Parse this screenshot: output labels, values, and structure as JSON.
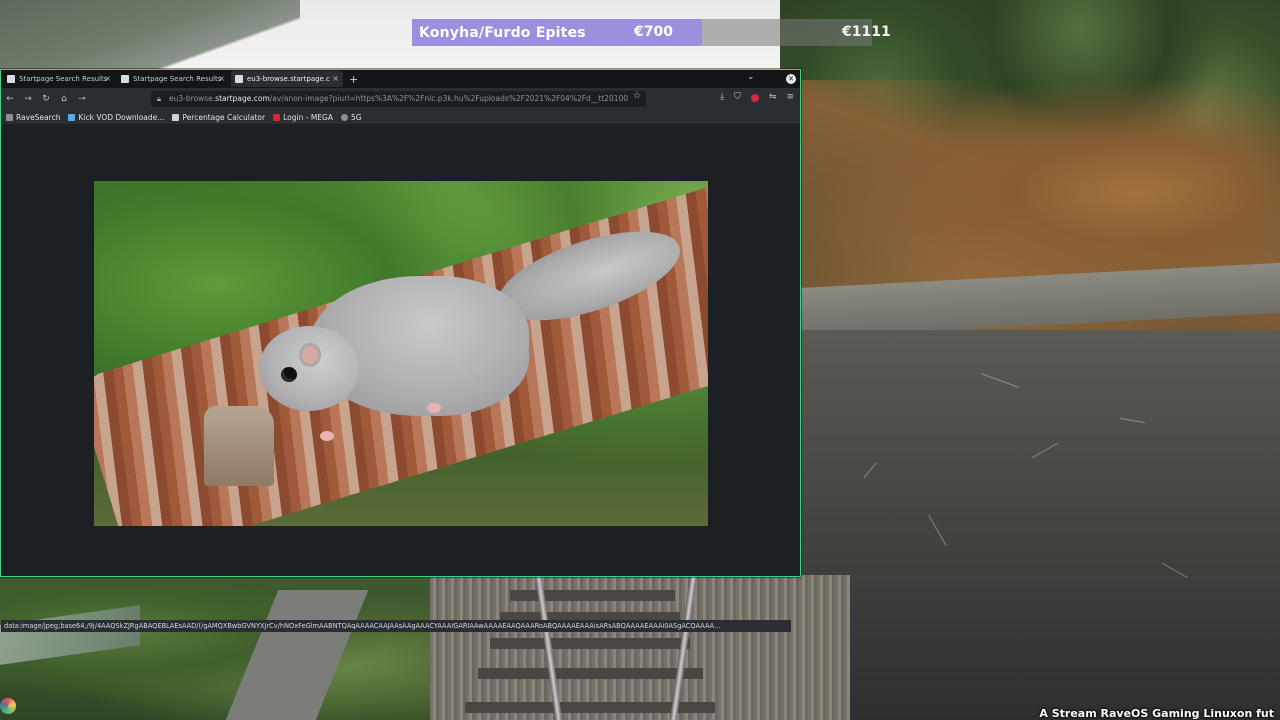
{
  "donation": {
    "title": "Konyha/Furdo Epites",
    "current": "€700",
    "goal": "€1111",
    "progress": 0.63,
    "fill_color": "#9c90de"
  },
  "browser": {
    "tabs": [
      {
        "label": "Startpage Search Results",
        "active": false,
        "icon": "startpage-icon"
      },
      {
        "label": "Startpage Search Results",
        "active": false,
        "icon": "startpage-icon"
      },
      {
        "label": "eu3-browse.startpage.c",
        "active": true,
        "icon": "startpage-icon"
      }
    ],
    "new_tab": "+",
    "url": {
      "prefix": "eu3-browse.",
      "domain": "startpage.com",
      "path": "/av/anon-image?piurl=https%3A%2F%2Fnlc.p3k.hu%2Fuploads%2F2021%2F04%2Fd__tt20100"
    },
    "bookmarks": [
      {
        "label": "RaveSearch",
        "icon": "ravesearch-icon"
      },
      {
        "label": "Kick VOD Downloade...",
        "icon": "kick-icon"
      },
      {
        "label": "Percentage Calculator",
        "icon": "calculator-icon"
      },
      {
        "label": "Login - MEGA",
        "icon": "mega-icon"
      },
      {
        "label": "5G",
        "icon": "globe-icon"
      }
    ],
    "status_text": "data:image/jpeg;base64,/9j/4AAQSkZJRgABAQEBLAEsAAD/(/gAMQXBwbGVNYXJrCv/hNOxFeGlmAABNTQAqAAAACAAJAAsAAgAAACYAAAIGARIAAwAAAAEAAQAAARoABQAAAAEAAAisARsABQAAAAEAAAi0ASgACQAAAA...",
    "accent_color": "#3fd68a"
  },
  "stream_caption": "A Stream RaveOS Gaming Linuxon fut"
}
